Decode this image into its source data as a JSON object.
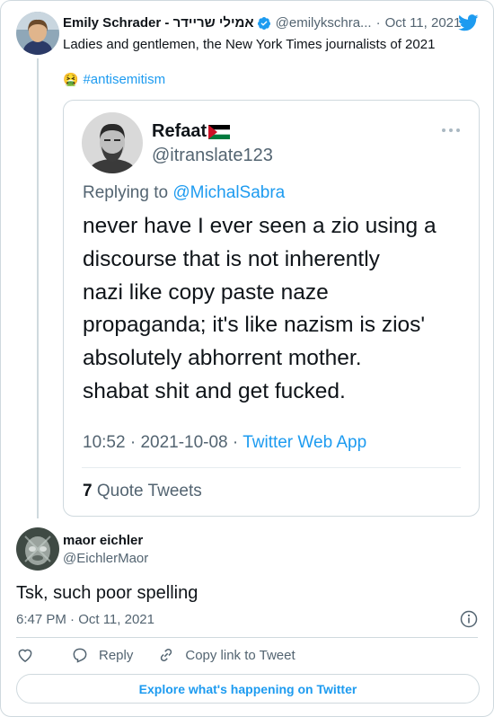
{
  "parent_tweet": {
    "display_name": "Emily Schrader - אמילי שריידר",
    "handle": "@emilykschra...",
    "separator": "·",
    "date": "Oct 11, 2021",
    "text": "Ladies and gentlemen, the New York Times journalists of 2021",
    "emoji": "🤮",
    "hashtag": "#antisemitism"
  },
  "quoted_tweet": {
    "display_name": "Refaat",
    "handle": "@itranslate123",
    "replying_label": "Replying to",
    "replying_mention": "@MichalSabra",
    "lines": [
      "never have I ever seen a zio using a",
      "discourse that is not inherently",
      "nazi like copy paste naze",
      "propaganda; it's like nazism is zios'",
      "absolutely abhorrent mother.",
      "shabat shit and get fucked."
    ],
    "time": "10:52",
    "date": "2021-10-08",
    "source": "Twitter Web App",
    "quote_count": "7",
    "quote_label": "Quote Tweets"
  },
  "reply_tweet": {
    "display_name": "maor eichler",
    "handle": "@EichlerMaor",
    "text": "Tsk, such poor spelling",
    "timestamp": "6:47 PM · Oct 11, 2021",
    "reply_label": "Reply",
    "copy_link_label": "Copy link to Tweet"
  },
  "footer": {
    "explore_label": "Explore what's happening on Twitter"
  },
  "colors": {
    "accent": "#1d9bf0",
    "secondary_text": "#536471",
    "border": "#cfd9de"
  },
  "icons": [
    "verified-badge-icon",
    "twitter-bird-icon",
    "more-options-icon",
    "palestine-flag-icon",
    "info-icon",
    "heart-icon",
    "reply-icon",
    "copy-link-icon"
  ]
}
